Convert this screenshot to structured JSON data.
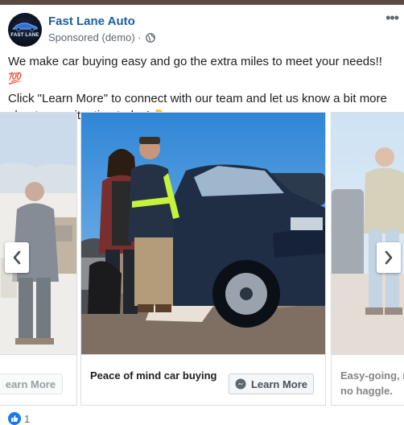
{
  "post": {
    "page_name": "Fast Lane Auto",
    "sponsored_label": "Sponsored (demo) ·",
    "more_icon": "•••",
    "avatar_text": "FAST LANE",
    "body_line1": "We make car buying easy and go the extra miles to meet your needs!!",
    "body_line1_emoji": "💯",
    "body_line2": "Click \"Learn More\" to connect with our team and let us know a bit more about your situation today!",
    "body_line2_emoji": "👇"
  },
  "carousel": {
    "cards": [
      {
        "headline": "",
        "cta": "Learn More",
        "cta_visible": "earn More"
      },
      {
        "headline": "Peace of mind car buying",
        "cta": "Learn More"
      },
      {
        "headline": "Easy-going, no haggle.",
        "headline_line1": "Easy-going, r",
        "headline_line2": "no haggle."
      }
    ],
    "prev_icon": "chevron-left-icon",
    "next_icon": "chevron-right-icon"
  },
  "reactions": {
    "like_count": "1"
  },
  "colors": {
    "page_name": "#1d5fa0",
    "like_blue": "#1877f2",
    "background": "#5b4a40"
  }
}
